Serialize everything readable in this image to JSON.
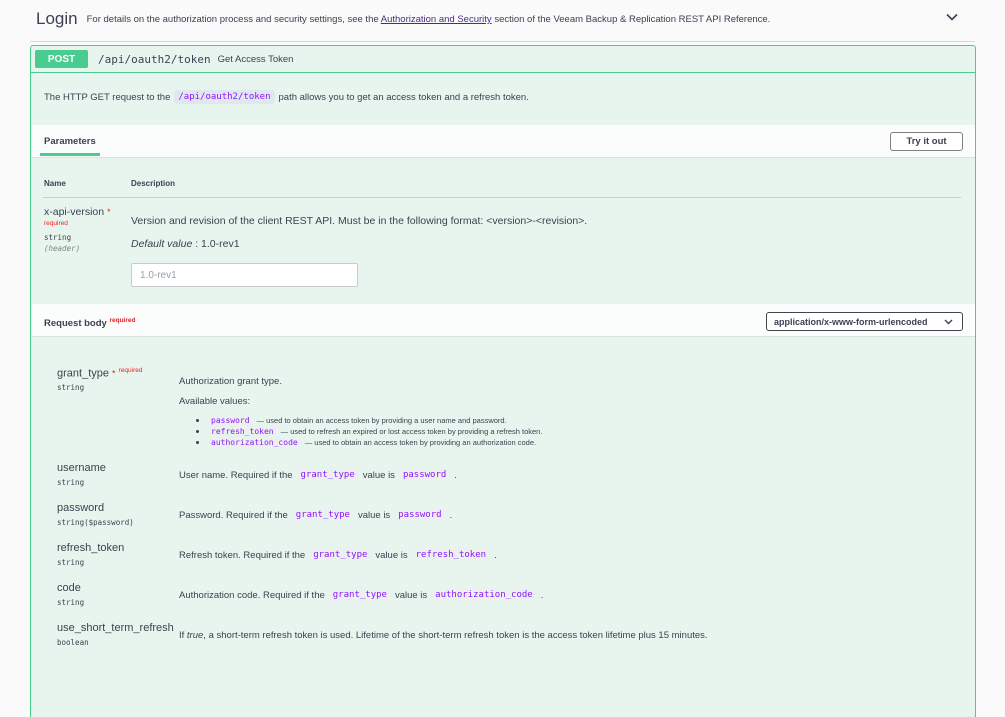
{
  "tag": {
    "title": "Login",
    "desc_before": "For details on the authorization process and security settings, see the",
    "link": "Authorization and Security",
    "desc_after": "section of the Veeam Backup & Replication REST API Reference."
  },
  "operation": {
    "method": "POST",
    "path": "/api/oauth2/token",
    "summary": "Get Access Token",
    "desc_before": "The HTTP GET request to the",
    "desc_code": "/api/oauth2/token",
    "desc_after": "path allows you to get an access token and a refresh token."
  },
  "parameters": {
    "tab_label": "Parameters",
    "try_button": "Try it out",
    "col_name": "Name",
    "col_description": "Description",
    "param": {
      "name": "x-api-version",
      "star": "*",
      "required_label": "required",
      "type": "string",
      "in": "(header)",
      "description": "Version and revision of the client REST API. Must be in the following format: <version>-<revision>.",
      "default_label": "Default value",
      "default_value": ": 1.0-rev1",
      "input_value": "1.0-rev1"
    }
  },
  "request_body": {
    "title": "Request body",
    "required_label": "required",
    "content_type": "application/x-www-form-urlencoded",
    "properties": [
      {
        "name": "grant_type",
        "star": "*",
        "required_label": "required",
        "type": "string",
        "description": "Authorization grant type.",
        "available_title": "Available values:",
        "enum": [
          {
            "code": "password",
            "text": "— used to obtain an access token by providing a user name and password."
          },
          {
            "code": "refresh_token",
            "text": "— used to refresh an expired or lost access token by providing a refresh token."
          },
          {
            "code": "authorization_code",
            "text": "— used to obtain an access token by providing an authorization code."
          }
        ]
      },
      {
        "name": "username",
        "type": "string",
        "d1": "User name. Required if the",
        "c1": "grant_type",
        "d2": "value is",
        "c2": "password",
        "d3": "."
      },
      {
        "name": "password",
        "type": "string($password)",
        "d1": "Password. Required if the",
        "c1": "grant_type",
        "d2": "value is",
        "c2": "password",
        "d3": "."
      },
      {
        "name": "refresh_token",
        "type": "string",
        "d1": "Refresh token. Required if the",
        "c1": "grant_type",
        "d2": "value is",
        "c2": "refresh_token",
        "d3": "."
      },
      {
        "name": "code",
        "type": "string",
        "d1": "Authorization code. Required if the",
        "c1": "grant_type",
        "d2": "value is",
        "c2": "authorization_code",
        "d3": "."
      },
      {
        "name": "use_short_term_refresh",
        "type": "boolean",
        "d1": "If",
        "d1_italic": "true",
        "d2": ", a short-term refresh token is used. Lifetime of the short-term refresh token is the access token lifetime plus 15 minutes."
      }
    ]
  },
  "icons": {
    "collapse": "chevron-down-icon",
    "select": "chevron-down-icon"
  },
  "colors": {
    "post": "#49cc90",
    "required": "#e82323",
    "code": "#9012fe"
  }
}
